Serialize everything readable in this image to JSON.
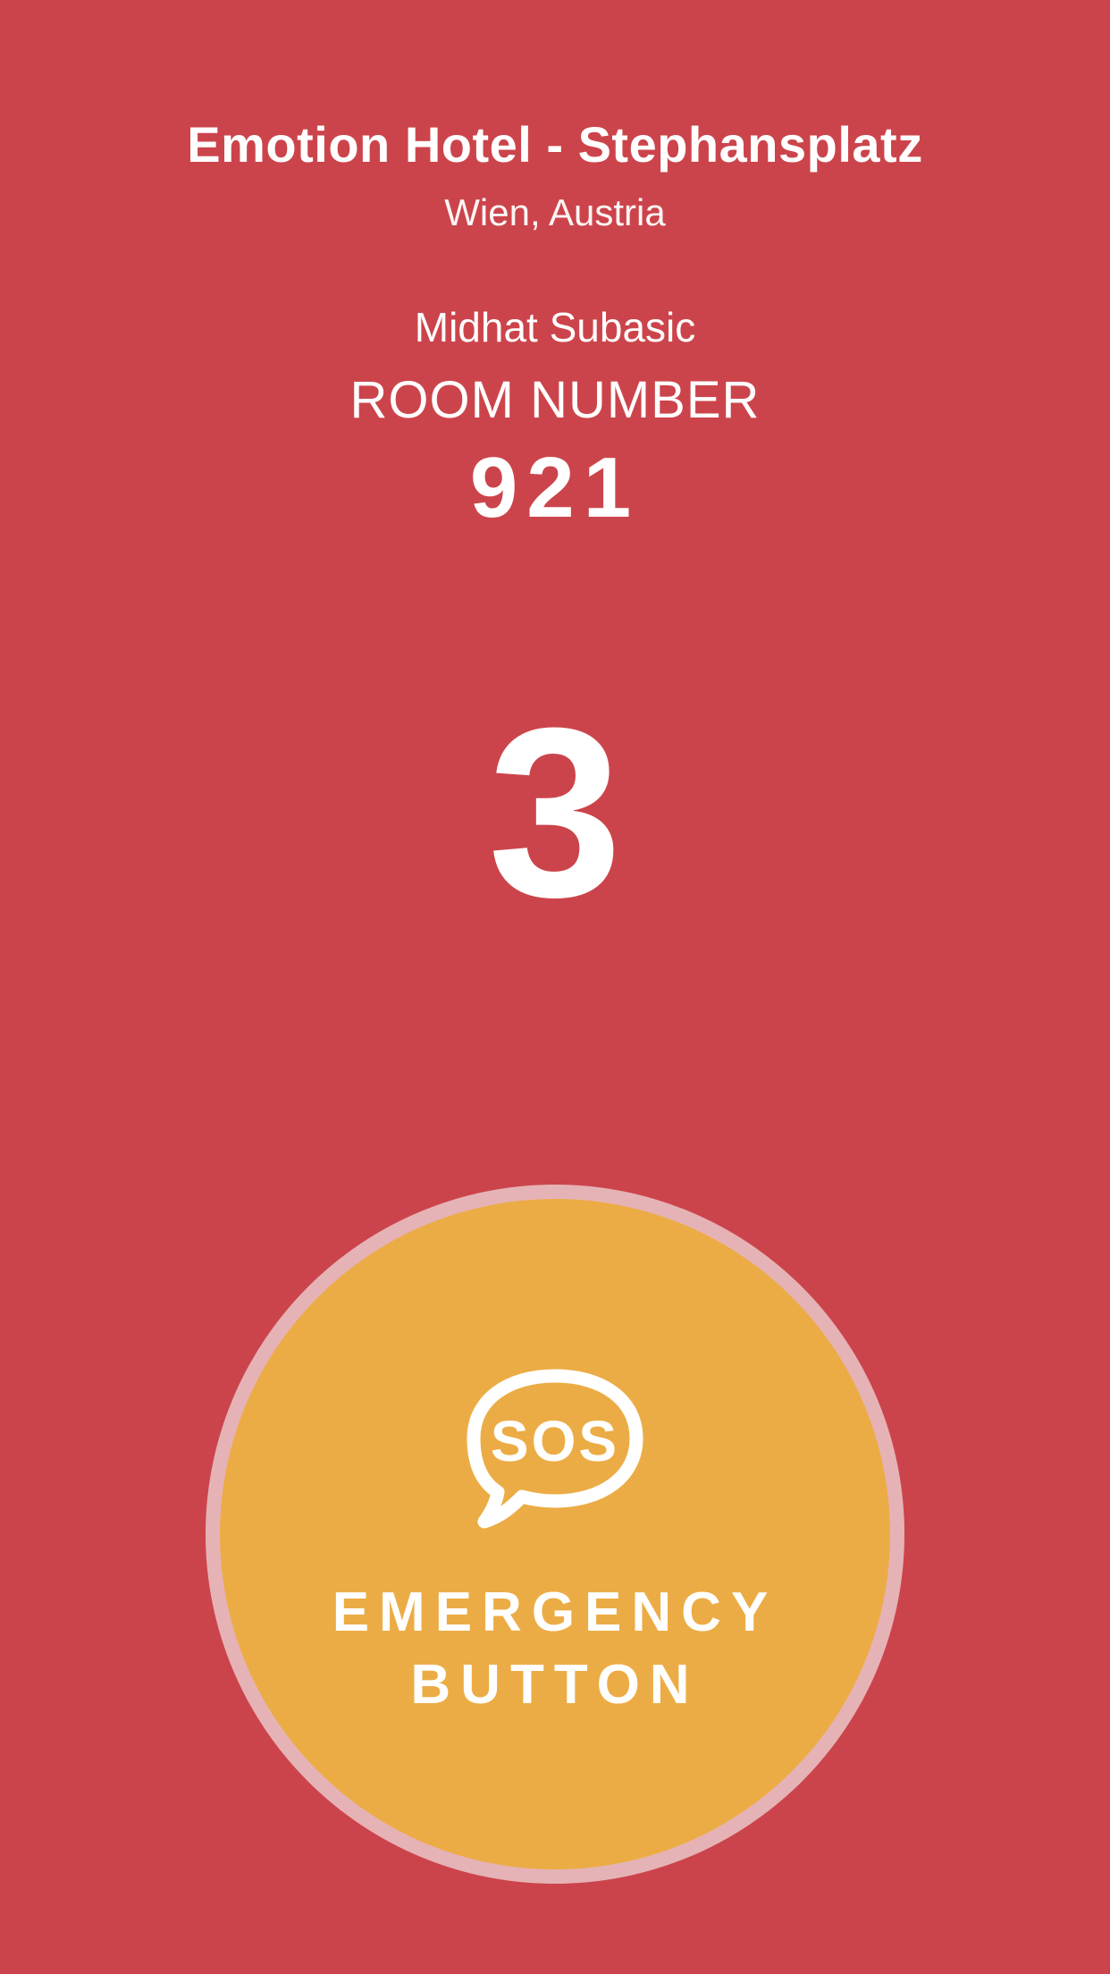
{
  "hotel": {
    "name": "Emotion Hotel - Stephansplatz",
    "location": "Wien, Austria"
  },
  "guest": {
    "name": "Midhat Subasic"
  },
  "room": {
    "label": "ROOM NUMBER",
    "number": "921"
  },
  "countdown": {
    "value": "3"
  },
  "emergency": {
    "icon": "sos-speech-bubble-icon",
    "icon_text": "SOS",
    "line1": "EMERGENCY",
    "line2": "BUTTON"
  },
  "colors": {
    "background": "#cc444b",
    "button": "#ecac45",
    "button_ring": "#e5b3b6",
    "text": "#ffffff"
  }
}
